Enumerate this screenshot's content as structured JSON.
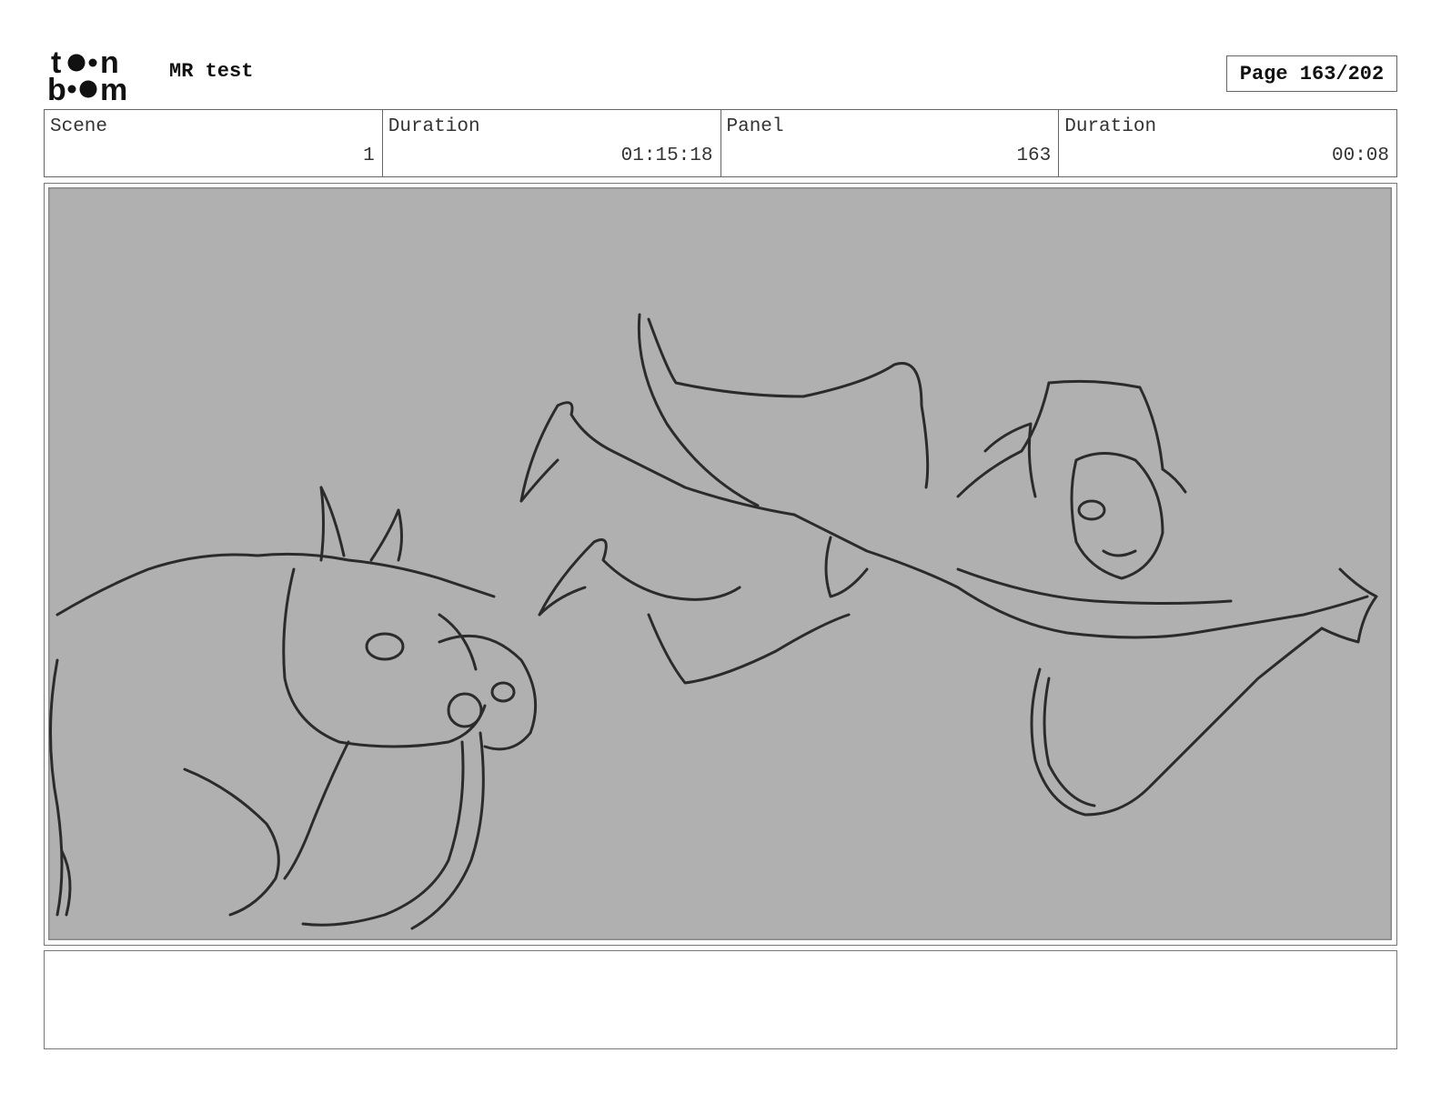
{
  "header": {
    "logo_text": "toon boom",
    "project_title": "MR test",
    "page_label": "Page 163/202"
  },
  "info": {
    "scene_label": "Scene",
    "scene_value": "1",
    "scene_duration_label": "Duration",
    "scene_duration_value": "01:15:18",
    "panel_label": "Panel",
    "panel_value": "163",
    "panel_duration_label": "Duration",
    "panel_duration_value": "00:08"
  },
  "panel": {
    "background_color": "#b0b0b0",
    "line_color": "#2b2b2b"
  },
  "notes": {
    "text": ""
  }
}
